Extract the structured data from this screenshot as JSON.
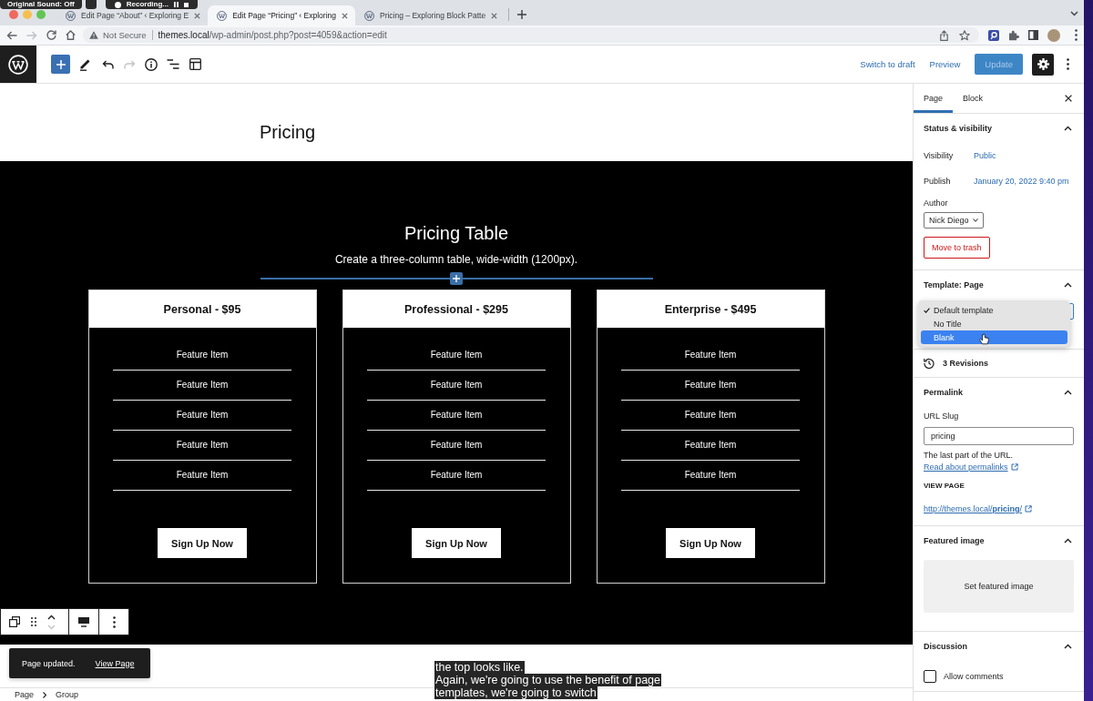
{
  "recorder": {
    "sound": "Original Sound: Off",
    "status": "Recording..."
  },
  "browser": {
    "tabs": [
      {
        "title": "Edit Page “About” ‹ Exploring E",
        "selected": false
      },
      {
        "title": "Edit Page “Pricing” ‹ Exploring",
        "selected": true
      },
      {
        "title": "Pricing – Exploring Block Patte",
        "selected": false
      }
    ],
    "address": {
      "security": "Not Secure",
      "url": "**themes.local**/wp-admin/post.php?post=4059&action=edit"
    }
  },
  "editor_header": {
    "actions": [
      {
        "kind": "link",
        "label": "Switch to draft"
      },
      {
        "kind": "link",
        "label": "Preview"
      },
      {
        "kind": "primary",
        "label": "Update",
        "disabled": true
      }
    ],
    "settings": {
      "pressed": true
    }
  },
  "page": {
    "title": "Pricing",
    "section": {
      "title": "Pricing Table",
      "subtitle": "Create a three-column table, wide-width (1200px).",
      "plans": [
        {
          "name": "Personal - $95",
          "features": [
            "Feature Item",
            "Feature Item",
            "Feature Item",
            "Feature Item",
            "Feature Item"
          ],
          "button": "Sign Up Now"
        },
        {
          "name": "Professional - $295",
          "features": [
            "Feature Item",
            "Feature Item",
            "Feature Item",
            "Feature Item",
            "Feature Item"
          ],
          "button": "Sign Up Now"
        },
        {
          "name": "Enterprise - $495",
          "features": [
            "Feature Item",
            "Feature Item",
            "Feature Item",
            "Feature Item",
            "Feature Item"
          ],
          "button": "Sign Up Now"
        }
      ]
    }
  },
  "snackbar": {
    "message": "Page updated.",
    "action": "View Page"
  },
  "breadcrumbs": [
    "Page",
    "Group"
  ],
  "sidebar": {
    "tabs": [
      {
        "label": "Page",
        "selected": true
      },
      {
        "label": "Block",
        "selected": false
      }
    ],
    "panels": [
      {
        "kind": "status",
        "title": "Status & visibility",
        "expanded": true,
        "rows": [
          {
            "label": "Visibility",
            "value": "Public"
          },
          {
            "label": "Publish",
            "value": "January 20, 2022 9:40 pm"
          }
        ],
        "author_label": "Author",
        "author": "Nick Diego",
        "trash": "Move to trash"
      },
      {
        "kind": "template",
        "title": "Template: Page",
        "expanded": true,
        "options": [
          {
            "label": "Default template",
            "checked": true,
            "selected": false
          },
          {
            "label": "No Title",
            "checked": false,
            "selected": false
          },
          {
            "label": "Blank",
            "checked": false,
            "selected": true
          }
        ]
      },
      {
        "kind": "revisions",
        "label": "3 Revisions"
      },
      {
        "kind": "permalink",
        "title": "Permalink",
        "expanded": true,
        "slug_label": "URL Slug",
        "slug": "pricing",
        "help": "The last part of the URL.",
        "help_link": "Read about permalinks",
        "view_label": "VIEW PAGE",
        "view_url": "http://themes.local/**pricing**/"
      },
      {
        "kind": "featured",
        "title": "Featured image",
        "expanded": true,
        "button": "Set featured image"
      },
      {
        "kind": "discussion",
        "title": "Discussion",
        "expanded": true,
        "checkbox": {
          "label": "Allow comments",
          "checked": false
        }
      }
    ]
  },
  "captions": [
    "the top looks like.",
    "Again, we're going to use the benefit of page",
    "templates, we're going to switch"
  ]
}
